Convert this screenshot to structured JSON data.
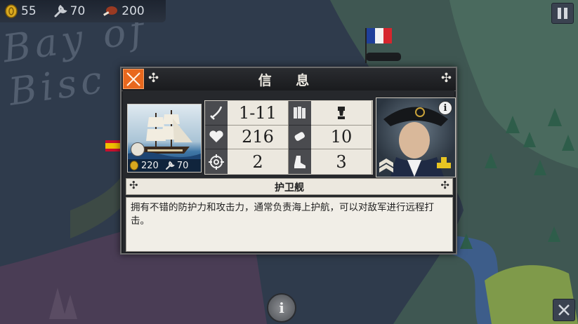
{
  "resources": [
    {
      "icon": "gold-coin-icon",
      "value": "55"
    },
    {
      "icon": "wrench-icon",
      "value": "70"
    },
    {
      "icon": "meat-icon",
      "value": "200"
    }
  ],
  "map": {
    "label_lines": [
      "Bay of",
      "Bisc"
    ]
  },
  "dialog": {
    "title": "信 息",
    "unit": {
      "gold_cost": "220",
      "industry_cost": "70",
      "name": "护卫舰",
      "description": "拥有不错的防护力和攻击力，通常负责海上护航，可以对敌军进行远程打击。"
    },
    "stats": [
      {
        "icon": "sword-icon",
        "value": "1-11"
      },
      {
        "icon": "soldiers-icon",
        "value": "",
        "extra_icon": "cannon-shell-icon"
      },
      {
        "icon": "heart-icon",
        "value": "216"
      },
      {
        "icon": "supply-icon",
        "value": "10"
      },
      {
        "icon": "crosshair-icon",
        "value": "2"
      },
      {
        "icon": "boot-icon",
        "value": "3"
      }
    ]
  },
  "colors": {
    "close_button": "#e8681e",
    "sea": "#2f3b4c",
    "panel": "#ece8df"
  }
}
